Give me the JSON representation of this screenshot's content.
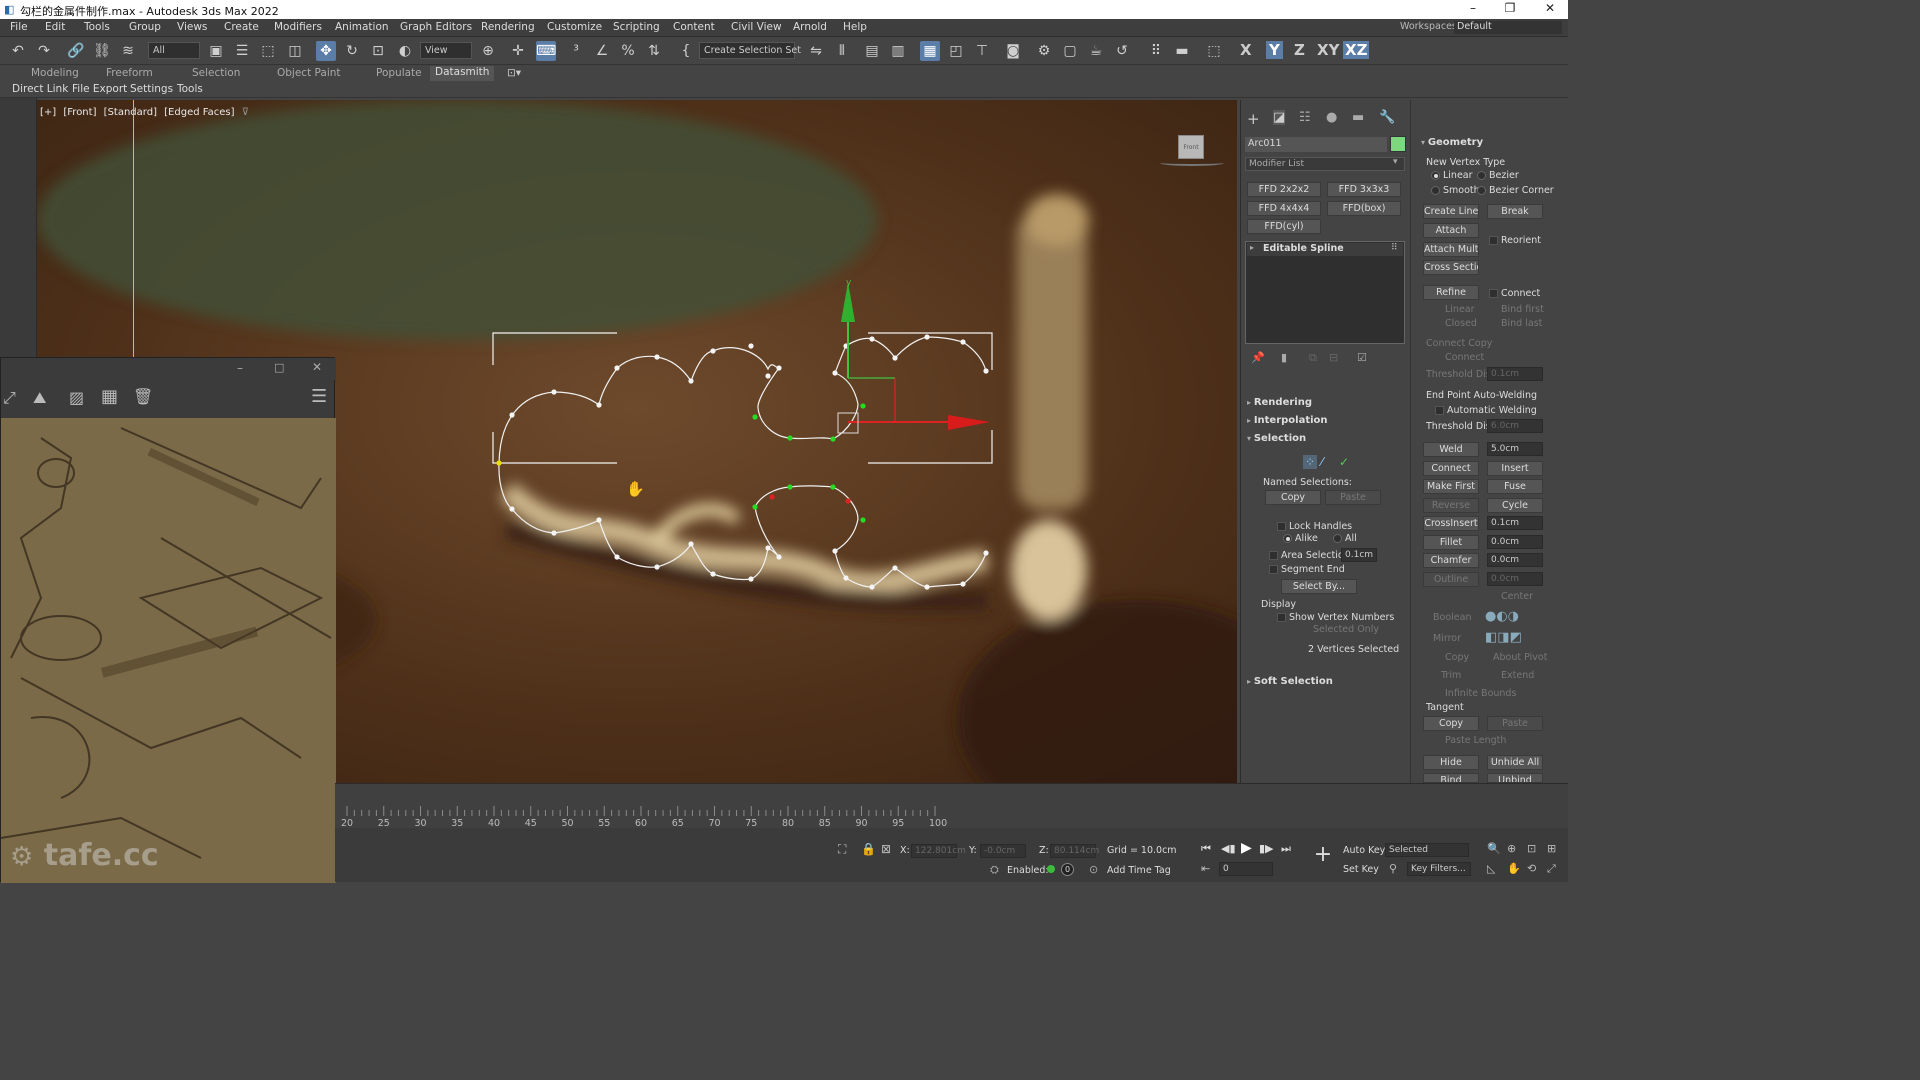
{
  "title_bar": {
    "title": "勾栏的金属件制作.max - Autodesk 3ds Max 2022",
    "minimize": "–",
    "restore": "❐",
    "close": "✕"
  },
  "menu": [
    "File",
    "Edit",
    "Tools",
    "Group",
    "Views",
    "Create",
    "Modifiers",
    "Animation",
    "Graph Editors",
    "Rendering",
    "Customize",
    "Scripting",
    "Content",
    "Civil View",
    "Arnold",
    "Help"
  ],
  "workspaces": {
    "label": "Workspaces:",
    "value": "Default"
  },
  "toolbar": {
    "filter": "All",
    "refcoord": "View",
    "selection_set": "Create Selection Set",
    "axes": [
      "X",
      "Y",
      "Z",
      "XY",
      "XZ"
    ]
  },
  "ribbon_tabs": [
    "Modeling",
    "Freeform",
    "Selection",
    "Object Paint",
    "Populate",
    "Datasmith"
  ],
  "sub_tabs": [
    "Direct Link",
    "File Export",
    "Settings",
    "Tools"
  ],
  "viewport": {
    "labels": [
      "[+]",
      "[Front]",
      "[Standard]",
      "[Edged Faces]"
    ],
    "viewcube": "Front"
  },
  "command_panel": {
    "object_name": "Arc011",
    "object_color": "#7ed67e",
    "modifier_list": "Modifier List",
    "ffd_buttons": [
      "FFD 2x2x2",
      "FFD 3x3x3",
      "FFD 4x4x4",
      "FFD(box)",
      "FFD(cyl)"
    ],
    "stack_item": "Editable Spline",
    "rollouts": {
      "rendering": "Rendering",
      "interpolation": "Interpolation",
      "selection": "Selection",
      "soft_selection": "Soft Selection"
    },
    "selection": {
      "named_selections": "Named Selections:",
      "copy": "Copy",
      "paste": "Paste",
      "lock_handles": "Lock Handles",
      "alike": "Alike",
      "all": "All",
      "area_selection": "Area Selection",
      "area_value": "0.1cm",
      "segment_end": "Segment End",
      "select_by": "Select By...",
      "display": "Display",
      "show_vertex_numbers": "Show Vertex Numbers",
      "selected_only": "Selected Only",
      "status": "2 Vertices Selected"
    }
  },
  "geometry": {
    "title": "Geometry",
    "new_vertex_type": "New Vertex Type",
    "linear": "Linear",
    "bezier": "Bezier",
    "smooth": "Smooth",
    "bezier_corner": "Bezier Corner",
    "create_line": "Create Line",
    "break": "Break",
    "attach": "Attach",
    "reorient": "Reorient",
    "attach_mult": "Attach Mult.",
    "cross_section": "Cross Section",
    "refine": "Refine",
    "connect": "Connect",
    "linear2": "Linear",
    "bind_first": "Bind first",
    "closed": "Closed",
    "bind_last": "Bind last",
    "connect_copy": "Connect Copy",
    "connect2": "Connect",
    "threshold_dist": "Threshold Dist",
    "threshold_value1": "0.1cm",
    "end_point_auto_welding": "End Point Auto-Welding",
    "automatic_welding": "Automatic Welding",
    "threshold_value2": "6.0cm",
    "weld": "Weld",
    "weld_value": "5.0cm",
    "connect3": "Connect",
    "insert": "Insert",
    "make_first": "Make First",
    "fuse": "Fuse",
    "reverse": "Reverse",
    "cycle": "Cycle",
    "crossinsert": "CrossInsert",
    "crossinsert_value": "0.1cm",
    "fillet": "Fillet",
    "fillet_value": "0.0cm",
    "chamfer": "Chamfer",
    "chamfer_value": "0.0cm",
    "outline": "Outline",
    "outline_value": "0.0cm",
    "center": "Center",
    "boolean": "Boolean",
    "mirror": "Mirror",
    "copy": "Copy",
    "about_pivot": "About Pivot",
    "trim": "Trim",
    "extend": "Extend",
    "infinite_bounds": "Infinite Bounds",
    "tangent": "Tangent",
    "tcopy": "Copy",
    "tpaste": "Paste",
    "paste_length": "Paste Length",
    "hide": "Hide",
    "unhide_all": "Unhide All",
    "bind": "Bind",
    "unbind": "Unbind"
  },
  "timeline": {
    "ticks": [
      20,
      25,
      30,
      35,
      40,
      45,
      50,
      55,
      60,
      65,
      70,
      75,
      80,
      85,
      90,
      95,
      100
    ]
  },
  "status": {
    "x_label": "X:",
    "x": "122.801cm",
    "y_label": "Y:",
    "y": "-0.0cm",
    "z_label": "Z:",
    "z": "80.114cm",
    "grid": "Grid = 10.0cm",
    "enabled": "Enabled:",
    "add_time_tag": "Add Time Tag",
    "auto_key": "Auto Key",
    "selected": "Selected",
    "set_key": "Set Key",
    "key_filters": "Key Filters...",
    "frame": "0"
  },
  "watermark": "tafe.cc"
}
